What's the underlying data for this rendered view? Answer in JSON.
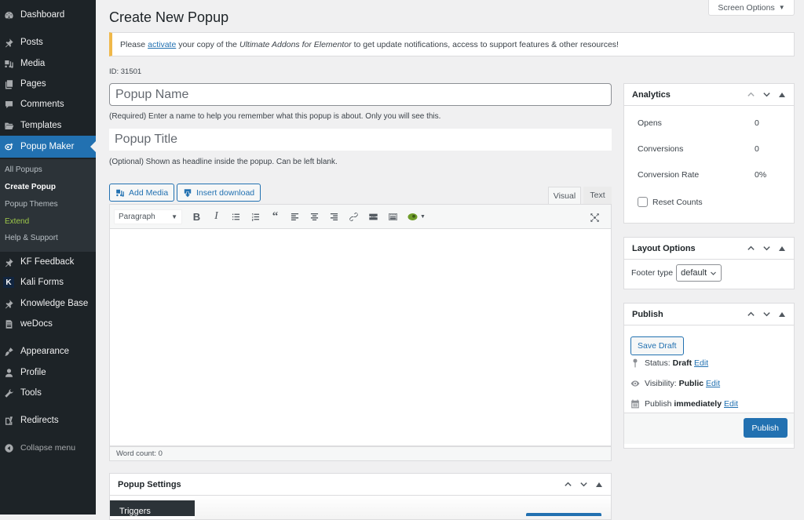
{
  "sidebar": {
    "items": [
      {
        "label": "Dashboard",
        "icon": "dashboard-icon"
      },
      {
        "label": "Posts",
        "icon": "pin-icon"
      },
      {
        "label": "Media",
        "icon": "media-icon"
      },
      {
        "label": "Pages",
        "icon": "pages-icon"
      },
      {
        "label": "Comments",
        "icon": "comment-icon"
      },
      {
        "label": "Templates",
        "icon": "folder-icon"
      },
      {
        "label": "Popup Maker",
        "icon": "popup-maker-icon",
        "active": true
      },
      {
        "label": "KF Feedback",
        "icon": "pin-icon"
      },
      {
        "label": "Kali Forms",
        "icon": "kali-forms-icon"
      },
      {
        "label": "Knowledge Base",
        "icon": "pin-icon"
      },
      {
        "label": "weDocs",
        "icon": "document-icon"
      },
      {
        "label": "Appearance",
        "icon": "paintbrush-icon"
      },
      {
        "label": "Profile",
        "icon": "user-icon"
      },
      {
        "label": "Tools",
        "icon": "wrench-icon"
      },
      {
        "label": "Redirects",
        "icon": "yoast-icon"
      }
    ],
    "submenu": [
      {
        "label": "All Popups"
      },
      {
        "label": "Create Popup",
        "current": true
      },
      {
        "label": "Popup Themes"
      },
      {
        "label": "Extend"
      },
      {
        "label": "Help & Support"
      }
    ],
    "collapse_label": "Collapse menu"
  },
  "screen_options": {
    "label": "Screen Options"
  },
  "page": {
    "title": "Create New Popup",
    "notice": {
      "prefix": "Please",
      "link": "activate",
      "middle": "your copy of the",
      "product": "Ultimate Addons for Elementor",
      "suffix": "to get update notifications, access to support features & other resources!"
    },
    "id_label": "ID: 31501"
  },
  "form": {
    "name_placeholder": "Popup Name",
    "name_value": "",
    "name_help": "(Required) Enter a name to help you remember what this popup is about. Only you will see this.",
    "title_placeholder": "Popup Title",
    "title_value": "",
    "title_help": "(Optional) Shown as headline inside the popup. Can be left blank."
  },
  "editor": {
    "add_media_label": "Add Media",
    "insert_download_label": "Insert download",
    "tabs": [
      {
        "label": "Visual",
        "active": true
      },
      {
        "label": "Text"
      }
    ],
    "format_value": "Paragraph",
    "toolbar_buttons": [
      "bold",
      "italic",
      "bulleted-list",
      "numbered-list",
      "blockquote",
      "align-left",
      "align-center",
      "align-right",
      "link",
      "read-more",
      "toolbar-toggle",
      "popup-maker-shortcode"
    ],
    "word_count": "Word count: 0"
  },
  "analytics": {
    "title": "Analytics",
    "rows": [
      {
        "label": "Opens",
        "value": "0"
      },
      {
        "label": "Conversions",
        "value": "0"
      },
      {
        "label": "Conversion Rate",
        "value": "0%"
      }
    ],
    "reset_label": "Reset Counts",
    "reset_checked": false
  },
  "layout_options": {
    "title": "Layout Options",
    "footer_label": "Footer type",
    "footer_value": "default"
  },
  "publish": {
    "title": "Publish",
    "save_draft_label": "Save Draft",
    "status_label": "Status:",
    "status_value": "Draft",
    "visibility_label": "Visibility:",
    "visibility_value": "Public",
    "publish_label": "Publish",
    "publish_when": "immediately",
    "edit_label": "Edit",
    "publish_button": "Publish"
  },
  "popup_settings": {
    "title": "Popup Settings",
    "tabs": [
      {
        "label": "Triggers",
        "active": true
      }
    ]
  },
  "colors": {
    "accent": "#2271b1",
    "sidebar_bg": "#1d2327",
    "submenu_bg": "#2c3338",
    "notice_border": "#f0b849",
    "extend_green": "#9ec84a"
  }
}
